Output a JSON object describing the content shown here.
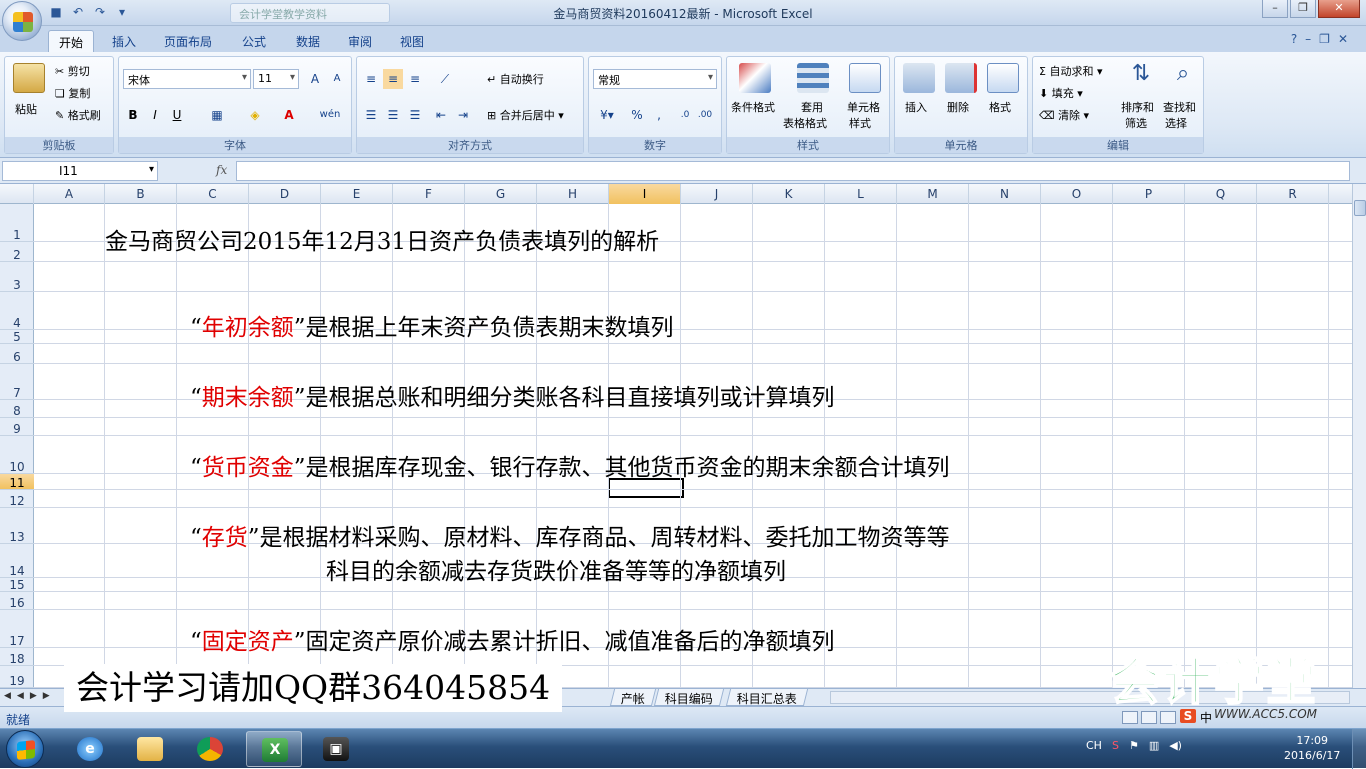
{
  "window": {
    "title": "金马商贸资料20160412最新 - Microsoft Excel",
    "doc_tab": "会计学堂教学资料"
  },
  "ribbon": {
    "tabs": [
      "开始",
      "插入",
      "页面布局",
      "公式",
      "数据",
      "审阅",
      "视图"
    ],
    "active_tab": "开始",
    "clipboard": {
      "paste": "粘贴",
      "cut": "剪切",
      "copy": "复制",
      "format_painter": "格式刷",
      "label": "剪贴板"
    },
    "font": {
      "name": "宋体",
      "size": "11",
      "label": "字体",
      "bold": "B",
      "italic": "I",
      "underline": "U",
      "phonetic": "wén"
    },
    "alignment": {
      "wrap": "自动换行",
      "merge": "合并后居中",
      "label": "对齐方式"
    },
    "number": {
      "format": "常规",
      "percent": "%",
      "comma": ",",
      "label": "数字"
    },
    "styles": {
      "cond_format": "条件格式",
      "table_format": "套用\n表格格式",
      "table_format_l1": "套用",
      "table_format_l2": "表格格式",
      "cell_style_l1": "单元格",
      "cell_style_l2": "样式",
      "label": "样式"
    },
    "cells": {
      "insert": "插入",
      "delete": "删除",
      "format": "格式",
      "label": "单元格"
    },
    "editing": {
      "autosum": "自动求和",
      "fill": "填充",
      "clear": "清除",
      "sort_l1": "排序和",
      "sort_l2": "筛选",
      "find_l1": "查找和",
      "find_l2": "选择",
      "label": "编辑"
    }
  },
  "formula_bar": {
    "name_box": "I11",
    "fx": "fx",
    "content": ""
  },
  "grid": {
    "columns": [
      "A",
      "B",
      "C",
      "D",
      "E",
      "F",
      "G",
      "H",
      "I",
      "J",
      "K",
      "L",
      "M",
      "N",
      "O",
      "P",
      "Q",
      "R"
    ],
    "selected_column": "I",
    "rows": [
      "1",
      "2",
      "3",
      "4",
      "5",
      "6",
      "7",
      "8",
      "9",
      "10",
      "11",
      "12",
      "13",
      "14",
      "15",
      "16",
      "17",
      "18",
      "19"
    ],
    "selected_row": "11"
  },
  "content": {
    "title": "金马商贸公司2015年12月31日资产负债表填列的解析",
    "items": [
      {
        "quote_open": "“",
        "term": "年初余额",
        "rest": "”是根据上年末资产负债表期末数填列"
      },
      {
        "quote_open": "“",
        "term": "期末余额",
        "rest": "”是根据总账和明细分类账各科目直接填列或计算填列"
      },
      {
        "quote_open": "“",
        "term": "货币资金",
        "rest": "”是根据库存现金、银行存款、其他货币资金的期末余额合计填列"
      },
      {
        "quote_open": "“",
        "term": "存货",
        "rest": "”是根据材料采购、原材料、库存商品、周转材料、委托加工物资等等",
        "cont": "科目的余额减去存货跌价准备等等的净额填列"
      },
      {
        "quote_open": "“",
        "term": "固定资产",
        "rest": "”固定资产原价减去累计折旧、减值准备后的净额填列"
      }
    ]
  },
  "sheet_tabs": [
    "产帐",
    "科目编码",
    "科目汇总表"
  ],
  "status_bar": {
    "text": "就绪"
  },
  "overlay": {
    "watermark": "会计学习请加QQ群364045854",
    "brand": "会计学堂",
    "brand_url": "WWW.ACC5.COM",
    "ime_label": "中"
  },
  "taskbar": {
    "tray_lang": "CH",
    "time": "17:09",
    "date": "2016/6/17"
  },
  "colors": {
    "accent_red": "#e00000",
    "selection_header": "#f1c15f",
    "brand_green": "#33b15a"
  }
}
